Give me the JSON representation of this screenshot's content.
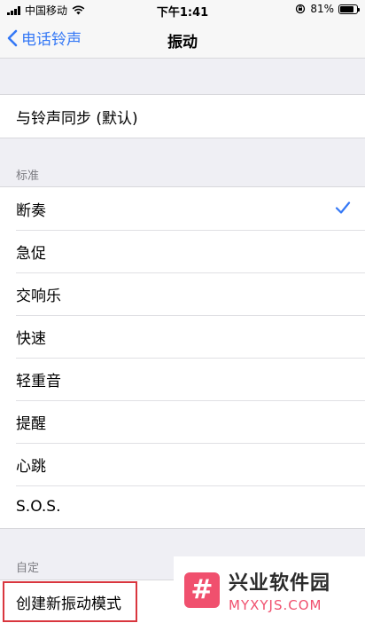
{
  "status_bar": {
    "carrier": "中国移动",
    "time": "下午1:41",
    "battery": "81%",
    "battery_level": 0.81
  },
  "nav": {
    "back_label": "电话铃声",
    "title": "振动"
  },
  "default_group": {
    "item": "与铃声同步 (默认)"
  },
  "standard": {
    "header": "标准",
    "items": [
      "断奏",
      "急促",
      "交响乐",
      "快速",
      "轻重音",
      "提醒",
      "心跳",
      "S.O.S."
    ],
    "selected_index": 0
  },
  "custom": {
    "header": "自定",
    "create_label": "创建新振动模式"
  },
  "watermark": {
    "logo_glyph": "#",
    "name": "兴业软件园",
    "site": "MYXYJS.COM"
  },
  "colors": {
    "accent": "#3478f6",
    "highlight": "#d9363e",
    "watermark": "#f0506e"
  }
}
